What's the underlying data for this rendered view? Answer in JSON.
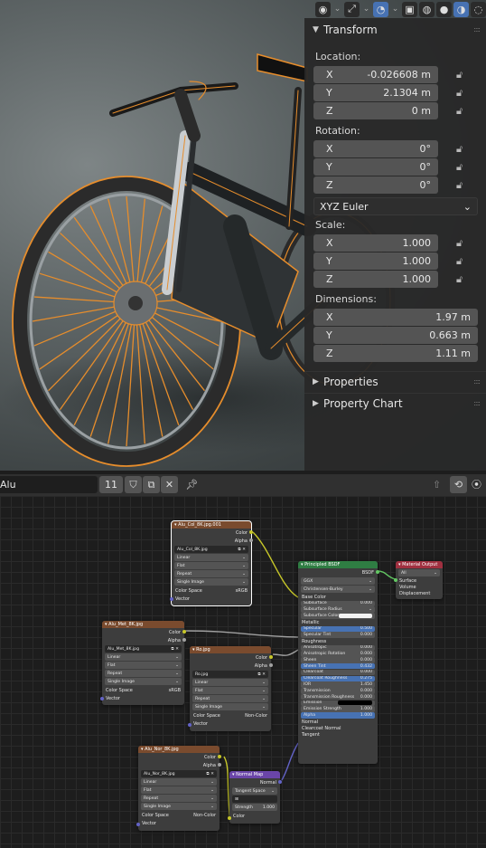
{
  "viewport": {
    "toolbar_icons": [
      "view-icon",
      "gizmo-icon",
      "overlay-icon",
      "xray-icon",
      "wireframe-shading-icon",
      "solid-shading-icon",
      "material-shading-icon",
      "rendered-shading-icon"
    ]
  },
  "transform": {
    "title": "Transform",
    "location_label": "Location:",
    "location": [
      {
        "axis": "X",
        "value": "-0.026608 m"
      },
      {
        "axis": "Y",
        "value": "2.1304 m"
      },
      {
        "axis": "Z",
        "value": "0 m"
      }
    ],
    "rotation_label": "Rotation:",
    "rotation": [
      {
        "axis": "X",
        "value": "0°"
      },
      {
        "axis": "Y",
        "value": "0°"
      },
      {
        "axis": "Z",
        "value": "0°"
      }
    ],
    "rotation_mode": "XYZ Euler",
    "scale_label": "Scale:",
    "scale": [
      {
        "axis": "X",
        "value": "1.000"
      },
      {
        "axis": "Y",
        "value": "1.000"
      },
      {
        "axis": "Z",
        "value": "1.000"
      }
    ],
    "dimensions_label": "Dimensions:",
    "dimensions": [
      {
        "axis": "X",
        "value": "1.97 m"
      },
      {
        "axis": "Y",
        "value": "0.663 m"
      },
      {
        "axis": "Z",
        "value": "1.11 m"
      }
    ]
  },
  "panels": {
    "properties": "Properties",
    "property_chart": "Property Chart"
  },
  "node_header": {
    "material_name": "Alu",
    "users": "11"
  },
  "nodes": {
    "col": {
      "title": "Alu_Col_8K.jpg.001",
      "out1": "Color",
      "out2": "Alpha",
      "image": "Alu_Col_8K.jpg",
      "interp": "Linear",
      "proj": "Flat",
      "ext": "Repeat",
      "src": "Single Image",
      "cs_label": "Color Space",
      "cs_val": "sRGB",
      "vec": "Vector"
    },
    "met": {
      "title": "Alu_Met_8K.jpg",
      "out1": "Color",
      "out2": "Alpha",
      "image": "Alu_Met_8K.jpg",
      "interp": "Linear",
      "proj": "Flat",
      "ext": "Repeat",
      "src": "Single Image",
      "cs_label": "Color Space",
      "cs_val": "sRGB",
      "vec": "Vector"
    },
    "ro": {
      "title": "Ro.jpg",
      "out1": "Color",
      "out2": "Alpha",
      "image": "Ro.jpg",
      "interp": "Linear",
      "proj": "Flat",
      "ext": "Repeat",
      "src": "Single Image",
      "cs_label": "Color Space",
      "cs_val": "Non-Color",
      "vec": "Vector"
    },
    "nor": {
      "title": "Alu_Nor_8K.jpg",
      "out1": "Color",
      "out2": "Alpha",
      "image": "Alu_Nor_8K.jpg",
      "interp": "Linear",
      "proj": "Flat",
      "ext": "Repeat",
      "src": "Single Image",
      "cs_label": "Color Space",
      "cs_val": "Non-Color",
      "vec": "Vector"
    },
    "normalmap": {
      "title": "Normal Map",
      "out": "Normal",
      "space": "Tangent Space",
      "strength_label": "Strength",
      "strength": "1.000",
      "color": "Color"
    },
    "bsdf": {
      "title": "Principled BSDF",
      "out": "BSDF",
      "dist": "GGX",
      "sss": "Christensen-Burley",
      "rows": [
        {
          "label": "Base Color",
          "value": "",
          "kind": "socket"
        },
        {
          "label": "Subsurface",
          "value": "0.000",
          "kind": "field"
        },
        {
          "label": "Subsurface Radius",
          "value": "",
          "kind": "dropdown"
        },
        {
          "label": "Subsurface Color",
          "value": "",
          "kind": "swatch"
        },
        {
          "label": "Metallic",
          "value": "",
          "kind": "socket"
        },
        {
          "label": "Specular",
          "value": "0.500",
          "kind": "blue"
        },
        {
          "label": "Specular Tint",
          "value": "0.000",
          "kind": "field"
        },
        {
          "label": "Roughness",
          "value": "",
          "kind": "socket"
        },
        {
          "label": "Anisotropic",
          "value": "0.000",
          "kind": "field"
        },
        {
          "label": "Anisotropic Rotation",
          "value": "0.000",
          "kind": "field"
        },
        {
          "label": "Sheen",
          "value": "0.000",
          "kind": "field"
        },
        {
          "label": "Sheen Tint",
          "value": "0.432",
          "kind": "blue"
        },
        {
          "label": "Clearcoat",
          "value": "0.000",
          "kind": "field"
        },
        {
          "label": "Clearcoat Roughness",
          "value": "0.275",
          "kind": "blue"
        },
        {
          "label": "IOR",
          "value": "1.450",
          "kind": "field"
        },
        {
          "label": "Transmission",
          "value": "0.000",
          "kind": "field"
        },
        {
          "label": "Transmission Roughness",
          "value": "0.000",
          "kind": "field"
        },
        {
          "label": "Emission",
          "value": "",
          "kind": "black"
        },
        {
          "label": "Emission Strength",
          "value": "1.000",
          "kind": "field"
        },
        {
          "label": "Alpha",
          "value": "1.000",
          "kind": "blue"
        },
        {
          "label": "Normal",
          "value": "",
          "kind": "socket"
        },
        {
          "label": "Clearcoat Normal",
          "value": "",
          "kind": "socket"
        },
        {
          "label": "Tangent",
          "value": "",
          "kind": "socket"
        }
      ]
    },
    "output": {
      "title": "Material Output",
      "target": "All",
      "in1": "Surface",
      "in2": "Volume",
      "in3": "Displacement"
    }
  }
}
